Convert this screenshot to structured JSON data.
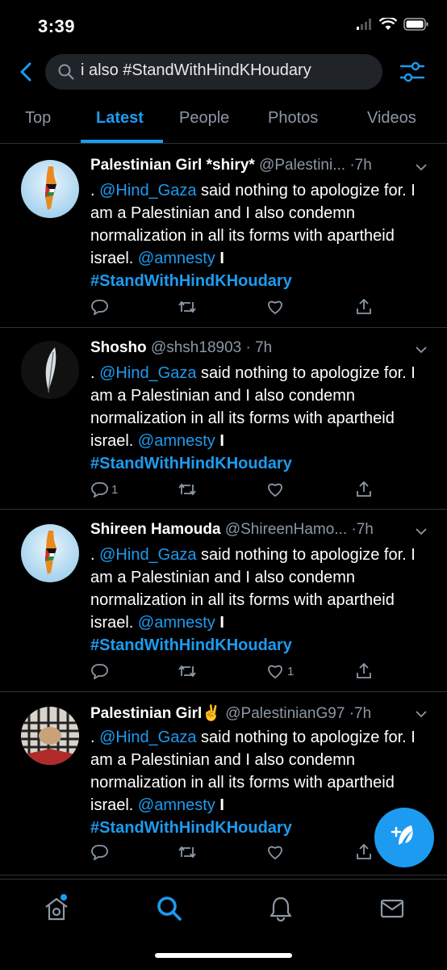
{
  "status_bar": {
    "time": "3:39"
  },
  "search": {
    "query": "i also #StandWithHindKHoudary"
  },
  "tabs": [
    {
      "label": "Top"
    },
    {
      "label": "Latest"
    },
    {
      "label": "People"
    },
    {
      "label": "Photos"
    },
    {
      "label": "Videos"
    }
  ],
  "active_tab": "Latest",
  "tweets": [
    {
      "name": "Palestinian Girl *shiry*",
      "handle": "@Palestini...",
      "time": "·7h",
      "text_part1": ". ",
      "mention1": "@Hind_Gaza",
      "text_part2": " said nothing to apologize for. I am a Palestinian and I also condemn normalization in all its forms with apartheid israel. ",
      "mention2": "@amnesty",
      "text_part3": " I",
      "hashtag": "#StandWithHindKHoudary",
      "reply_count": "",
      "like_count": ""
    },
    {
      "name": "Shosho",
      "handle": "@shsh18903",
      "time": "· 7h",
      "text_part1": ". ",
      "mention1": "@Hind_Gaza",
      "text_part2": " said nothing to apologize for. I am a Palestinian and I also condemn normalization in all its forms with apartheid israel. ",
      "mention2": "@amnesty",
      "text_part3": " I",
      "hashtag": "#StandWithHindKHoudary",
      "reply_count": "1",
      "like_count": ""
    },
    {
      "name": "Shireen Hamouda",
      "handle": "@ShireenHamo...",
      "time": "·7h",
      "text_part1": ". ",
      "mention1": "@Hind_Gaza",
      "text_part2": " said nothing to apologize for. I am a Palestinian and I also condemn normalization in all its forms with apartheid israel. ",
      "mention2": "@amnesty",
      "text_part3": " I",
      "hashtag": "#StandWithHindKHoudary",
      "reply_count": "",
      "like_count": "1"
    },
    {
      "name": "Palestinian Girl✌️",
      "handle": "@PalestinianG97",
      "time": "·7h",
      "text_part1": ". ",
      "mention1": "@Hind_Gaza",
      "text_part2": " said nothing to apologize for. I am a Palestinian and I also condemn normalization in all its forms with apartheid israel. ",
      "mention2": "@amnesty",
      "text_part3": " I",
      "hashtag": "#StandWithHindKHoudary",
      "reply_count": "",
      "like_count": ""
    }
  ],
  "icons": {
    "back": "chevron-left-icon",
    "search": "search-icon",
    "filter": "filter-sliders-icon",
    "reply": "reply-icon",
    "retweet": "retweet-icon",
    "like": "heart-icon",
    "share": "share-icon",
    "compose": "compose-tweet-icon",
    "home": "home-icon",
    "explore": "search-icon",
    "notifications": "bell-icon",
    "messages": "mail-icon"
  },
  "colors": {
    "accent": "#1d9bf0",
    "background": "#000000",
    "muted": "#8b98a5",
    "divider": "#2f3336"
  }
}
